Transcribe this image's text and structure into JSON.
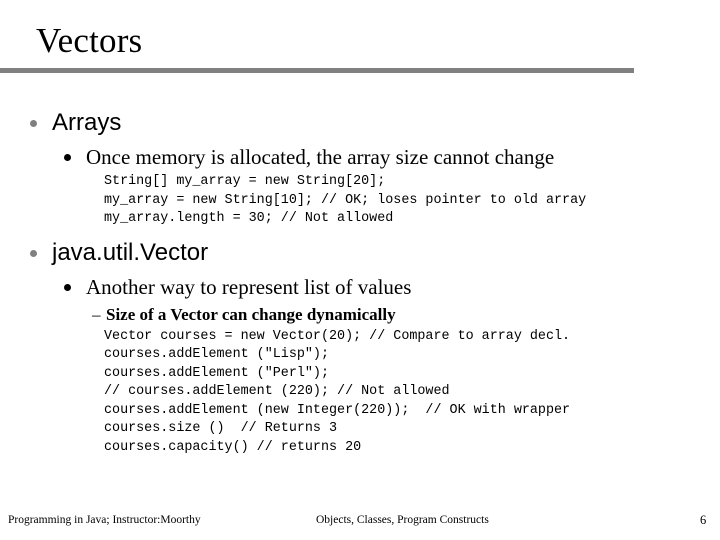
{
  "slide": {
    "title": "Vectors",
    "page_number": "6",
    "rule_color": "#808080",
    "bullet_l1_color": "#808080",
    "bullet_l2_color": "#000000"
  },
  "content": {
    "arrays": {
      "heading": "Arrays",
      "point": "Once memory is allocated, the array size cannot change",
      "code": "String[] my_array = new String[20];\nmy_array = new String[10]; // OK; loses pointer to old array\nmy_array.length = 30; // Not allowed"
    },
    "vector": {
      "heading": "java.util.Vector",
      "point": "Another way to represent list of values",
      "subpoint": "Size of a Vector can change dynamically",
      "dash": "–",
      "code": "Vector courses = new Vector(20); // Compare to array decl.\ncourses.addElement (\"Lisp\");\ncourses.addElement (\"Perl\");\n// courses.addElement (220); // Not allowed\ncourses.addElement (new Integer(220));  // OK with wrapper\ncourses.size ()  // Returns 3\ncourses.capacity() // returns 20"
    }
  },
  "footer": {
    "left": "Programming in Java; Instructor:Moorthy",
    "center": "Objects, Classes, Program Constructs",
    "page": "6"
  }
}
